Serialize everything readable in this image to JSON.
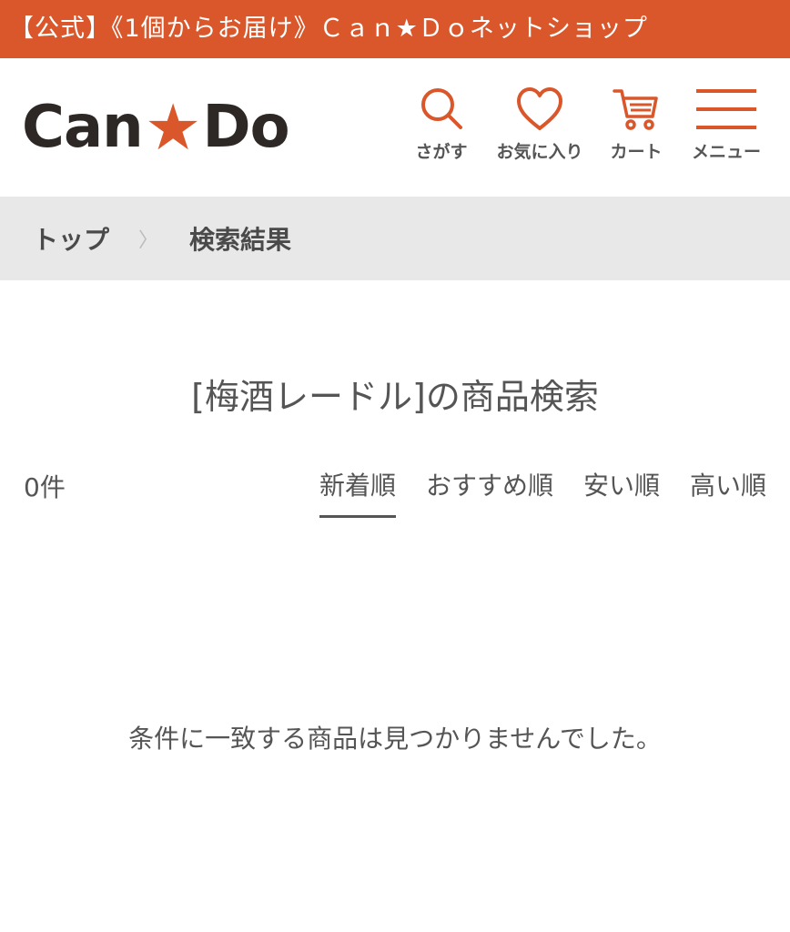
{
  "banner": {
    "text": "【公式】《1個からお届け》Ｃａｎ★Ｄｏネットショップ"
  },
  "header": {
    "logo": {
      "part1": "Can",
      "star": "★",
      "part2": "Do"
    },
    "search_label": "さがす",
    "favorites_label": "お気に入り",
    "cart_label": "カート",
    "menu_label": "メニュー"
  },
  "breadcrumb": {
    "items": [
      "トップ",
      "検索結果"
    ],
    "separator": "〉"
  },
  "search": {
    "title": "[梅酒レードル]の商品検索",
    "count": "0件",
    "sort_options": [
      "新着順",
      "おすすめ順",
      "安い順",
      "高い順"
    ],
    "active_sort": "新着順",
    "empty_message": "条件に一致する商品は見つかりませんでした。"
  },
  "colors": {
    "accent": "#d9572a",
    "text": "#4a4a4a",
    "breadcrumb_bg": "#e8e8e8"
  }
}
